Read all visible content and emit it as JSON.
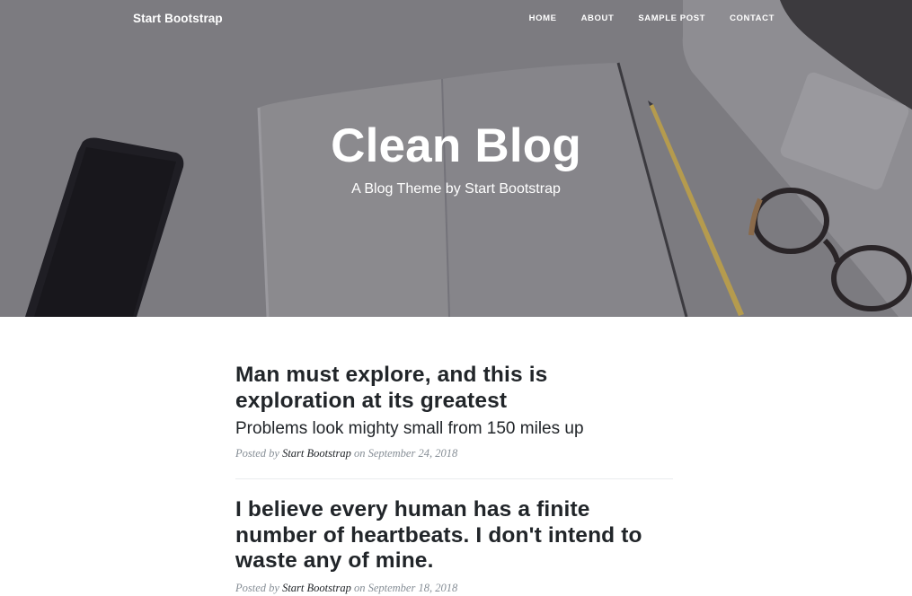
{
  "navbar": {
    "brand": "Start Bootstrap",
    "links": [
      {
        "label": "Home"
      },
      {
        "label": "About"
      },
      {
        "label": "Sample Post"
      },
      {
        "label": "Contact"
      }
    ]
  },
  "masthead": {
    "title": "Clean Blog",
    "subtitle": "A Blog Theme by Start Bootstrap"
  },
  "posts": [
    {
      "title": "Man must explore, and this is exploration at its greatest",
      "subtitle": "Problems look mighty small from 150 miles up",
      "posted_by_prefix": "Posted by",
      "author": "Start Bootstrap",
      "on_word": "on",
      "date": "September 24, 2018"
    },
    {
      "title": "I believe every human has a finite number of heartbeats. I don't intend to waste any of mine.",
      "subtitle": "",
      "posted_by_prefix": "Posted by",
      "author": "Start Bootstrap",
      "on_word": "on",
      "date": "September 18, 2018"
    }
  ],
  "colors": {
    "heading_text": "#212529",
    "meta_text": "#868e96",
    "header_overlay": "#5f5d64"
  }
}
